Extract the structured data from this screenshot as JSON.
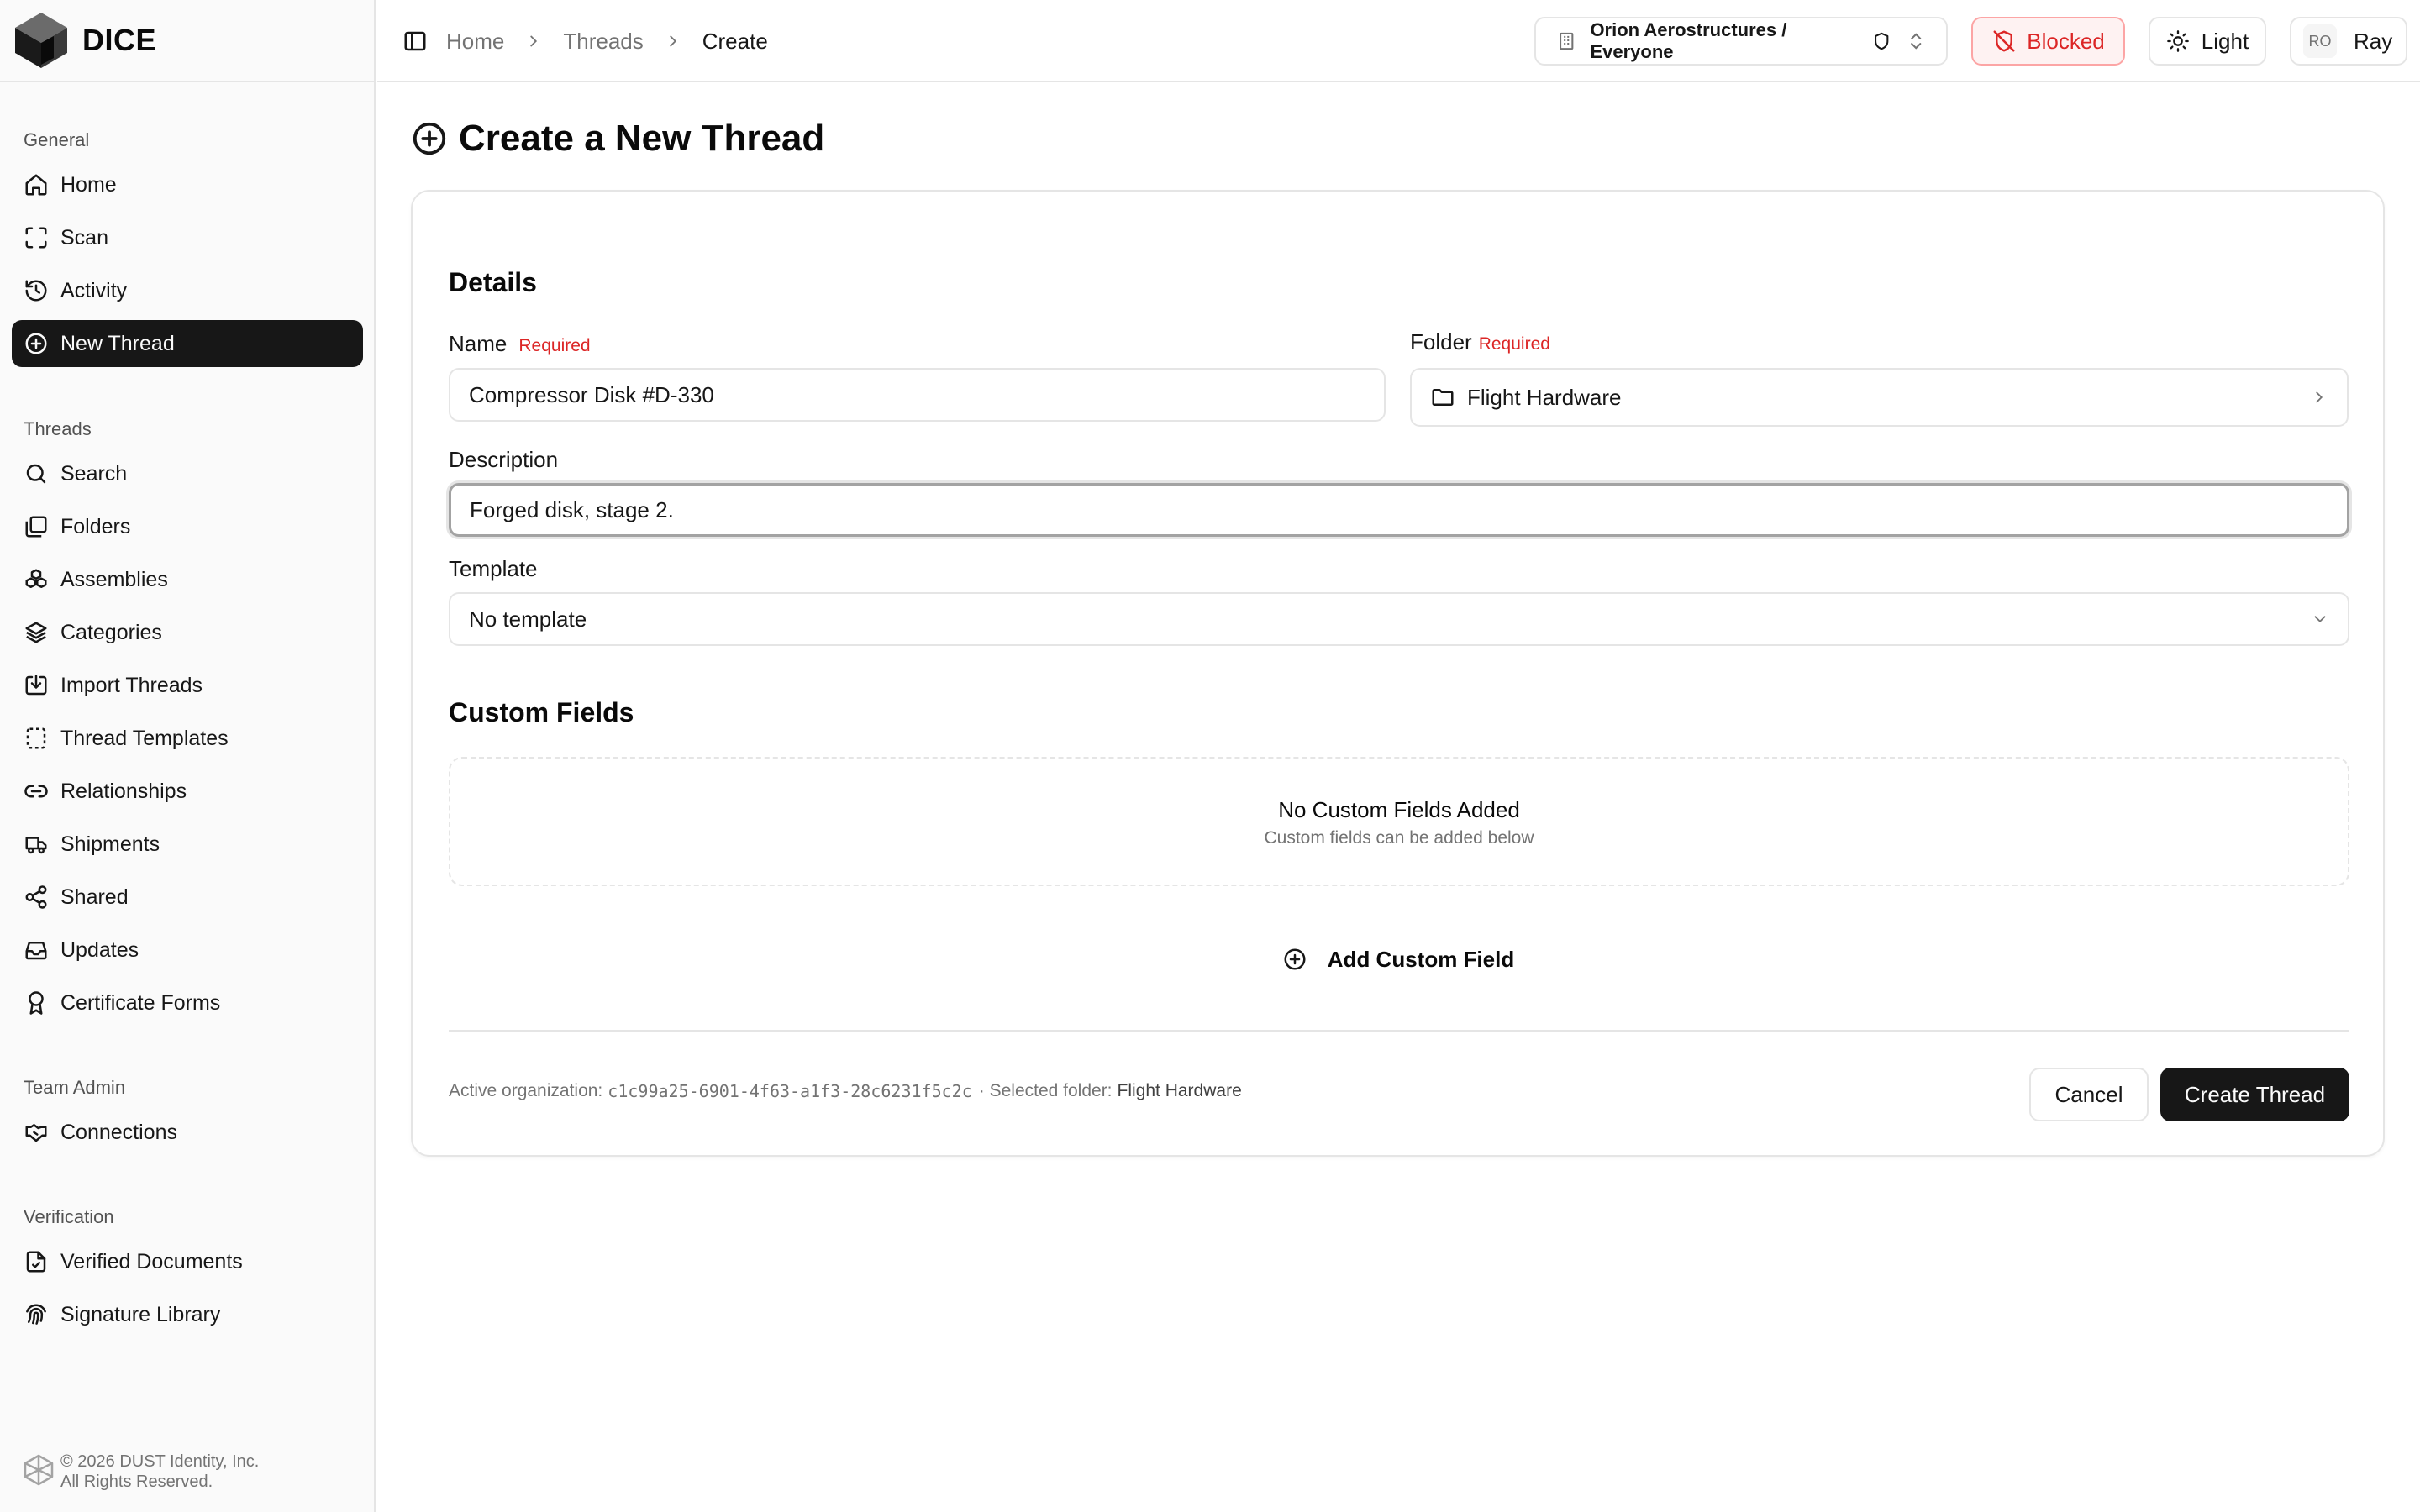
{
  "brand": {
    "name": "DICE"
  },
  "sidebar": {
    "groups": [
      {
        "label": "General",
        "items": [
          {
            "label": "Home",
            "icon": "home-icon"
          },
          {
            "label": "Scan",
            "icon": "scan-icon"
          },
          {
            "label": "Activity",
            "icon": "history-icon"
          },
          {
            "label": "New Thread",
            "icon": "plus-circle-icon",
            "active": true
          }
        ]
      },
      {
        "label": "Threads",
        "items": [
          {
            "label": "Search",
            "icon": "search-icon"
          },
          {
            "label": "Folders",
            "icon": "folders-icon"
          },
          {
            "label": "Assemblies",
            "icon": "boxes-icon"
          },
          {
            "label": "Categories",
            "icon": "layers-icon"
          },
          {
            "label": "Import Threads",
            "icon": "import-icon"
          },
          {
            "label": "Thread Templates",
            "icon": "template-icon"
          },
          {
            "label": "Relationships",
            "icon": "link-icon"
          },
          {
            "label": "Shipments",
            "icon": "truck-icon"
          },
          {
            "label": "Shared",
            "icon": "share-icon"
          },
          {
            "label": "Updates",
            "icon": "inbox-icon"
          },
          {
            "label": "Certificate Forms",
            "icon": "award-icon"
          }
        ]
      },
      {
        "label": "Team Admin",
        "items": [
          {
            "label": "Connections",
            "icon": "handshake-icon"
          }
        ]
      },
      {
        "label": "Verification",
        "items": [
          {
            "label": "Verified Documents",
            "icon": "file-check-icon"
          },
          {
            "label": "Signature Library",
            "icon": "fingerprint-icon"
          }
        ]
      }
    ],
    "footer": {
      "line1": "© 2026 DUST Identity, Inc.",
      "line2": "All Rights Reserved."
    }
  },
  "topbar": {
    "breadcrumb": [
      "Home",
      "Threads",
      "Create"
    ],
    "org_switcher": "Orion Aerostructures / Everyone",
    "blocked_label": "Blocked",
    "theme_label": "Light",
    "user": {
      "initials": "RO",
      "name": "Ray"
    }
  },
  "page": {
    "title": "Create a New Thread"
  },
  "form": {
    "details_title": "Details",
    "name": {
      "label": "Name",
      "required": "Required",
      "value": "Compressor Disk #D-330"
    },
    "folder": {
      "label": "Folder",
      "required": "Required",
      "value": "Flight Hardware"
    },
    "description": {
      "label": "Description",
      "value": "Forged disk, stage 2."
    },
    "template": {
      "label": "Template",
      "value": "No template"
    },
    "custom_fields": {
      "title": "Custom Fields",
      "empty_title": "No Custom Fields Added",
      "empty_subtitle": "Custom fields can be added below",
      "add_label": "Add Custom Field"
    },
    "footer": {
      "org_prefix": "Active organization:",
      "org_id": "c1c99a25-6901-4f63-a1f3-28c6231f5c2c",
      "folder_prefix": "· Selected folder:",
      "folder_name": "Flight Hardware",
      "cancel_label": "Cancel",
      "submit_label": "Create Thread"
    }
  },
  "colors": {
    "accent": "#171717",
    "danger": "#dc2626",
    "border": "#e5e5e5"
  }
}
